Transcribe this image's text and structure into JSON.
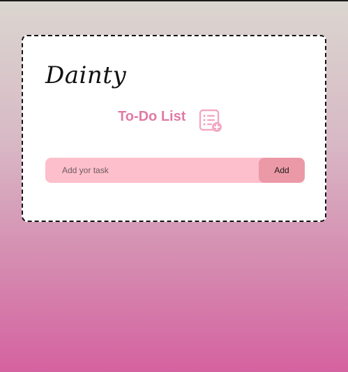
{
  "brand": {
    "name": "Dainty"
  },
  "todo": {
    "heading": "To-Do List",
    "heading_icon": "list-add-icon",
    "input_placeholder": "Add yor task",
    "input_value": "",
    "add_label": "Add"
  },
  "colors": {
    "accent": "#e17aa5",
    "input_background": "#fdbfcb",
    "button_background": "#ec99a7"
  }
}
